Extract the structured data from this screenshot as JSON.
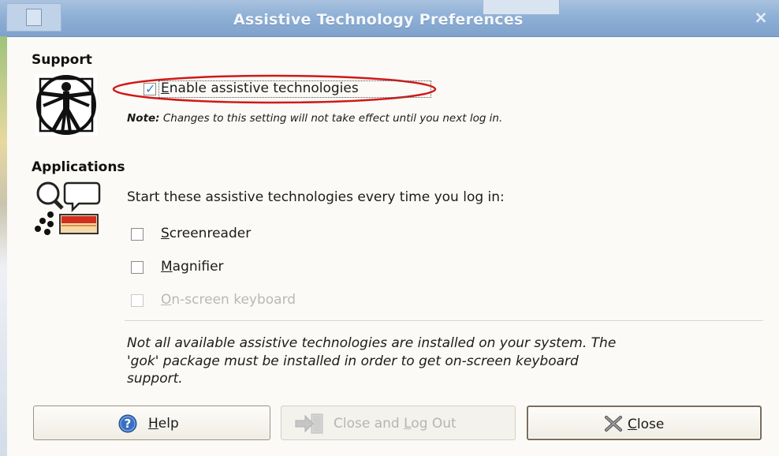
{
  "window": {
    "title": "Assistive Technology Preferences",
    "close_glyph": "×"
  },
  "support": {
    "heading": "Support",
    "icon": "vitruvian-man-icon",
    "enable_checkbox": {
      "label_mnemonic": "E",
      "label_rest": "nable assistive technologies",
      "checked": true
    },
    "note_prefix": "Note:",
    "note_text": " Changes to this setting will not take effect until you next log in."
  },
  "applications": {
    "heading": "Applications",
    "icon": "applications-icon",
    "intro": "Start these assistive technologies every time you log in:",
    "items": [
      {
        "mnemonic": "S",
        "rest": "creenreader",
        "checked": false,
        "enabled": true
      },
      {
        "mnemonic": "M",
        "rest": "agnifier",
        "checked": false,
        "enabled": true
      },
      {
        "mnemonic": "O",
        "rest": "n-screen keyboard",
        "checked": false,
        "enabled": false
      }
    ],
    "info_text": "Not all available assistive technologies are installed on your system.  The 'gok' package must be installed in order to get on-screen keyboard support."
  },
  "buttons": {
    "help": {
      "mnemonic": "H",
      "rest": "elp",
      "icon": "help-icon",
      "enabled": true
    },
    "close_logout": {
      "pre": "Close and ",
      "mnemonic": "L",
      "rest": "og Out",
      "icon": "logout-icon",
      "enabled": false
    },
    "close": {
      "mnemonic": "C",
      "rest": "lose",
      "icon": "close-icon",
      "enabled": true
    }
  },
  "colors": {
    "titlebar": "#8fb0d6",
    "annotation_ellipse": "#d01818",
    "checkmark": "#3c7ec8",
    "help_icon": "#3a6fbf"
  }
}
